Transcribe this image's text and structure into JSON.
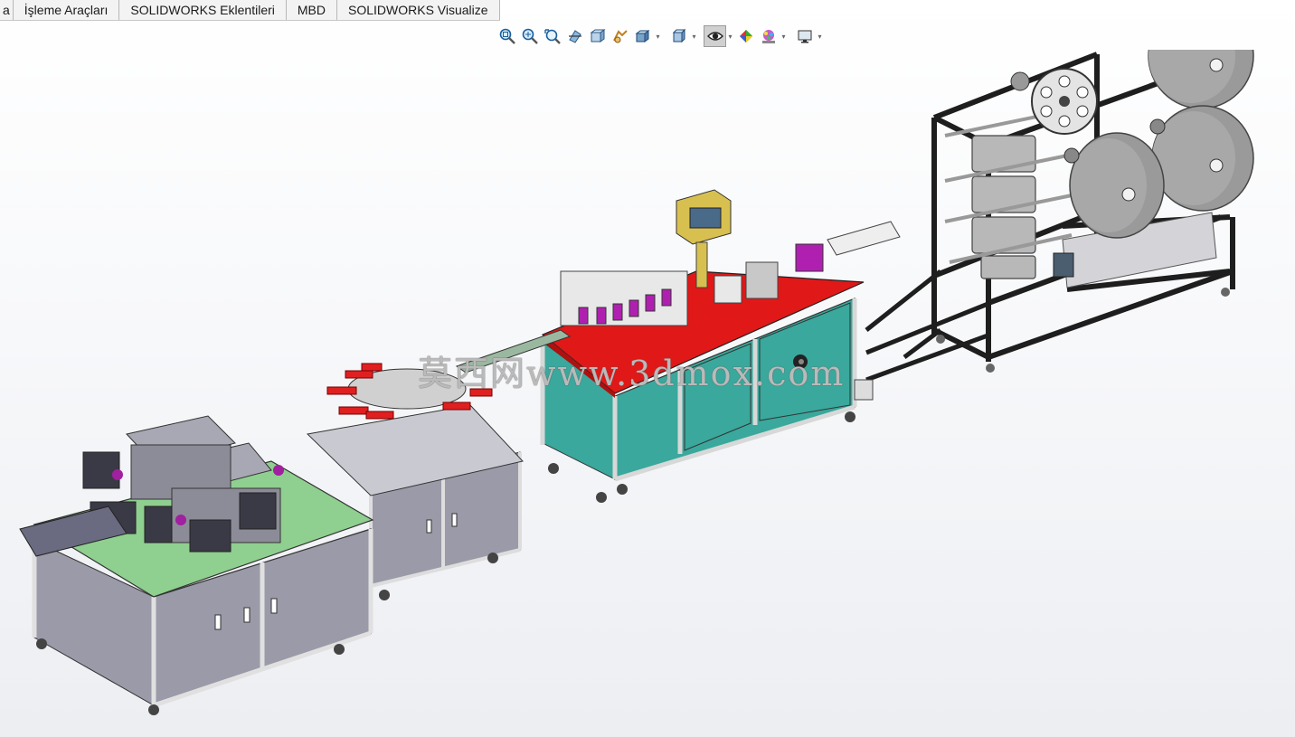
{
  "tabs": [
    {
      "label": "a"
    },
    {
      "label": "İşleme Araçları"
    },
    {
      "label": "SOLIDWORKS Eklentileri"
    },
    {
      "label": "MBD"
    },
    {
      "label": "SOLIDWORKS Visualize"
    }
  ],
  "toolbar": {
    "icons": [
      "zoom-to-fit-icon",
      "zoom-to-area-icon",
      "previous-view-icon",
      "section-view-icon",
      "dynamic-annotation-icon",
      "view-orientation-icon",
      "display-style-icon",
      "hide-show-items-icon",
      "edit-appearance-icon",
      "apply-scene-icon",
      "view-settings-icon"
    ]
  },
  "watermark": "莫西网www.3dmox.com",
  "colors": {
    "cabinet_teal": "#3aa89c",
    "table_red": "#e01818",
    "table_green": "#8fcf8f",
    "frame_dark": "#1e1e1e",
    "roll_gray": "#8a8a8a",
    "cabinet_gray": "#9a9aa8",
    "purple": "#b020b0"
  }
}
